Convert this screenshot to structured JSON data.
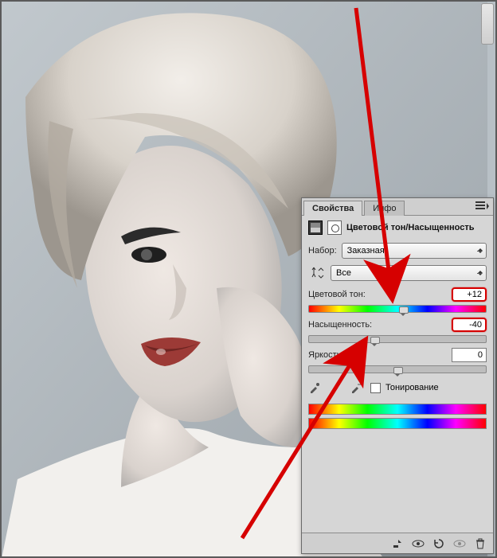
{
  "tabs": {
    "properties": "Свойства",
    "info": "Инфо"
  },
  "adjustment": {
    "title": "Цветовой тон/Насыщенность",
    "preset_label": "Набор:",
    "preset_value": "Заказная",
    "channel_value": "Все"
  },
  "sliders": {
    "hue": {
      "label": "Цветовой тон:",
      "value": "+12",
      "pos_pct": 53
    },
    "saturation": {
      "label": "Насыщенность:",
      "value": "-40",
      "pos_pct": 37
    },
    "lightness": {
      "label": "Яркость:",
      "value": "0",
      "pos_pct": 50
    }
  },
  "colorize_label": "Тонирование",
  "colors": {
    "highlight": "#d60000"
  }
}
